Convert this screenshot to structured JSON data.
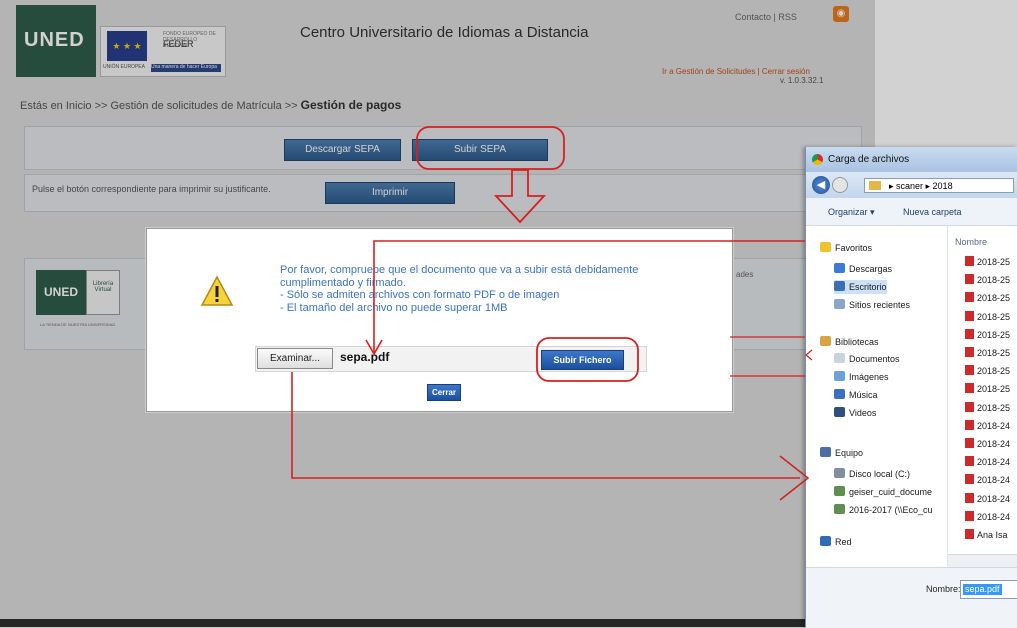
{
  "header": {
    "logo": "UNED",
    "eu_feder": "FEDER",
    "eu_small": "FONDO EUROPEO DE DESARROLLO REGIONAL",
    "eu_left": "UNIÓN EUROPEA",
    "eu_right": "Una manera de hacer Europa",
    "site_title": "Centro Universitario de Idiomas a Distancia",
    "top_links": "Contacto  |  RSS",
    "mgmt_links": "Ir a Gestión de Solicitudes  |  Cerrar sesión",
    "version": "v. 1.0.3.32.1"
  },
  "breadcrumb": {
    "prefix": "Estás en Inicio >> Gestión de solicitudes de Matrícula >>",
    "current": "Gestión de pagos"
  },
  "actions": {
    "descargar": "Descargar SEPA",
    "subir": "Subir SEPA",
    "print_text": "Pulse el botón correspondiente para imprimir su justificante.",
    "imprimir": "Imprimir"
  },
  "lower": {
    "uned": "UNED",
    "libreria": "Librería Virtual",
    "caption": "LA TIENDA DE NUESTRA UNIVERSIDAD",
    "ades": "ades"
  },
  "dialog": {
    "msg_line1": "Por favor, compruebe que el documento que va a subir está debidamente",
    "msg_line2": "cumplimentado y firmado.",
    "msg_line3": "- Sólo se admiten archivos con formato PDF o de imagen",
    "msg_line4": "- El tamaño del archivo no puede superar 1MB",
    "examinar": "Examinar...",
    "filename": "sepa.pdf",
    "subir_fichero": "Subir Fichero",
    "cerrar": "Cerrar"
  },
  "explorer": {
    "title": "Carga de archivos",
    "path": "▸ scaner ▸ 2018",
    "organizar": "Organizar ▾",
    "nueva_carpeta": "Nueva carpeta",
    "col_nombre": "Nombre",
    "nav": [
      {
        "label": "Favoritos",
        "icon": "star-icon"
      },
      {
        "label": "Descargas",
        "icon": "downloads-icon"
      },
      {
        "label": "Escritorio",
        "icon": "desktop-icon"
      },
      {
        "label": "Sitios recientes",
        "icon": "recent-icon"
      },
      {
        "label": "Bibliotecas",
        "icon": "library-icon"
      },
      {
        "label": "Documentos",
        "icon": "documents-icon"
      },
      {
        "label": "Imágenes",
        "icon": "images-icon"
      },
      {
        "label": "Música",
        "icon": "music-icon"
      },
      {
        "label": "Videos",
        "icon": "videos-icon"
      },
      {
        "label": "Equipo",
        "icon": "computer-icon"
      },
      {
        "label": "Disco local (C:)",
        "icon": "drive-icon"
      },
      {
        "label": "geiser_cuid_docume",
        "icon": "network-drive-icon"
      },
      {
        "label": "2016-2017 (\\\\Eco_cu",
        "icon": "network-drive-icon"
      },
      {
        "label": "Red",
        "icon": "network-icon"
      }
    ],
    "files": [
      "2018-25",
      "2018-25",
      "2018-25",
      "2018-25",
      "2018-25",
      "2018-25",
      "2018-25",
      "2018-25",
      "2018-25",
      "2018-24",
      "2018-24",
      "2018-24",
      "2018-24",
      "2018-24",
      "2018-24",
      "Ana Isa"
    ],
    "nombre_label": "Nombre:",
    "nombre_value": "sepa.pdf"
  },
  "colors": {
    "uned_green": "#2f5d4b",
    "button_blue": "#2d5c8e",
    "message_blue": "#3b73c6",
    "annotation_red": "#d62020"
  }
}
